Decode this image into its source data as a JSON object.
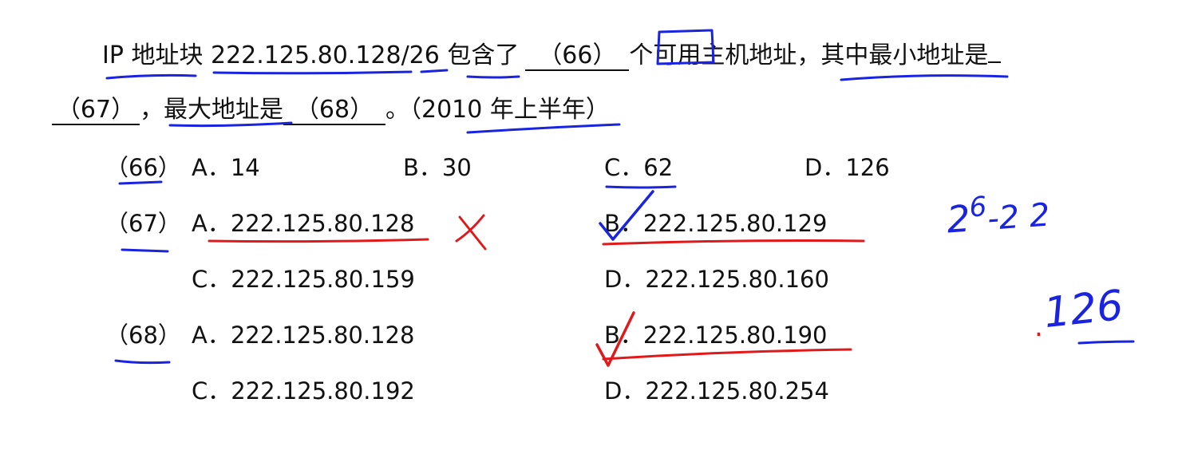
{
  "question": {
    "line1": {
      "p1": "IP 地址块 222.125.80.128/26 包含了",
      "b66": "（66）",
      "p2": "个可用主机地址，其中最小地址是"
    },
    "line2": {
      "b67": "（67）",
      "p3": "，最大地址是",
      "b68": "（68）",
      "p4": "。（2010 年上半年）"
    }
  },
  "q66": {
    "label": "（66）",
    "options": [
      "A．14",
      "B．30",
      "C．62",
      "D．126"
    ]
  },
  "q67": {
    "label": "（67）",
    "options": [
      "A．222.125.80.128",
      "B．222.125.80.129",
      "C．222.125.80.159",
      "D．222.125.80.160"
    ]
  },
  "q68": {
    "label": "（68）",
    "options": [
      "A．222.125.80.128",
      "B．222.125.80.190",
      "C．222.125.80.192",
      "D．222.125.80.254"
    ]
  },
  "handwriting": {
    "formula_base": "2",
    "formula_exp": "6",
    "formula_rest": "-2 2",
    "number": "126",
    "dot_mark": "."
  },
  "colors": {
    "blue_ink": "#1a24e0",
    "red_ink": "#e0191b",
    "text": "#111111"
  }
}
